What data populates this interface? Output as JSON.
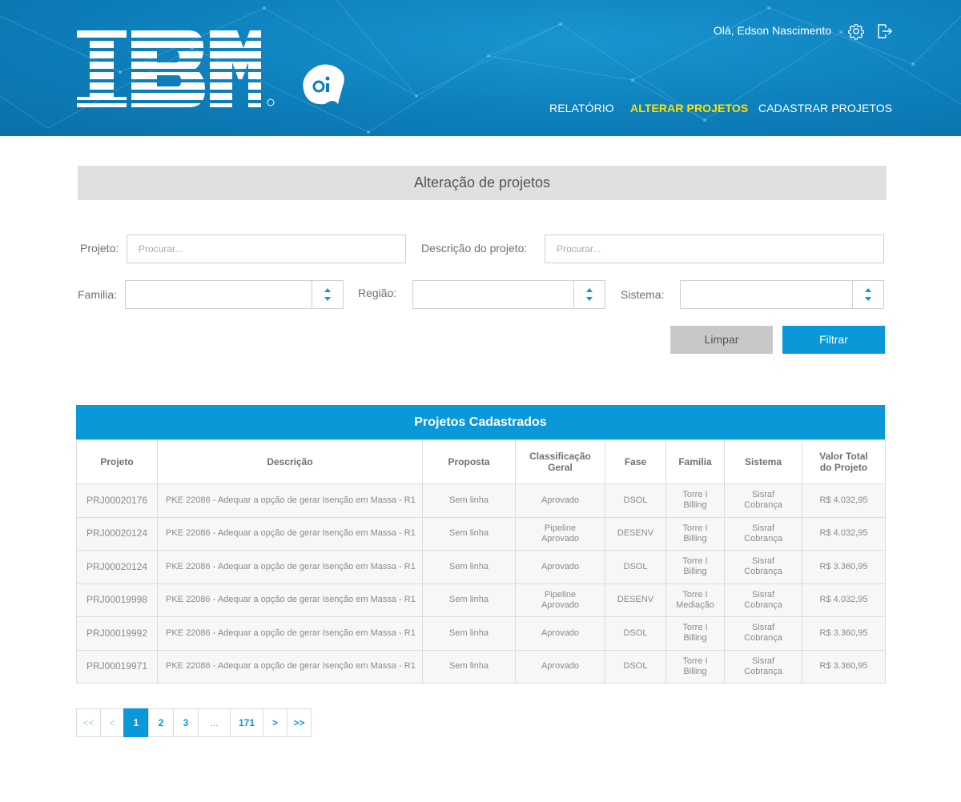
{
  "header": {
    "brand_primary": "IBM",
    "brand_secondary": "oi",
    "greeting": "Olá, Edson Nascimento",
    "icons": [
      "gear-icon",
      "logout-icon"
    ],
    "nav": [
      {
        "label": "RELATÓRIO",
        "active": false
      },
      {
        "label": "ALTERAR PROJETOS",
        "active": true
      },
      {
        "label": "CADASTRAR PROJETOS",
        "active": false
      }
    ]
  },
  "page_title": "Alteração de projetos",
  "filters": {
    "projeto": {
      "label": "Projeto:",
      "placeholder": "Procurar...",
      "value": ""
    },
    "descricao": {
      "label": "Descrição do projeto:",
      "placeholder": "Procurar...",
      "value": ""
    },
    "familia": {
      "label": "Familia:",
      "value": ""
    },
    "regiao": {
      "label": "Região:",
      "value": ""
    },
    "sistema": {
      "label": "Sistema:",
      "value": ""
    }
  },
  "buttons": {
    "clear": "Limpar",
    "filter": "Filtrar"
  },
  "table": {
    "title": "Projetos Cadastrados",
    "columns": [
      "Projeto",
      "Descrição",
      "Proposta",
      "Classificação Geral",
      "Fase",
      "Familia",
      "Sistema",
      "Valor Total do Projeto"
    ],
    "rows": [
      [
        "PRJ00020176",
        "PKE 22086 - Adequar a opção de gerar Isenção em Massa - R1",
        "Sem linha",
        "Aprovado",
        "DSOL",
        "Torre I Billing",
        "Sisraf Cobrança",
        "R$ 4.032,95"
      ],
      [
        "PRJ00020124",
        "PKE 22086 - Adequar a opção de gerar Isenção em Massa - R1",
        "Sem linha",
        "Pipeline Aprovado",
        "DESENV",
        "Torre I Billing",
        "Sisraf Cobrança",
        "R$ 4.032,95"
      ],
      [
        "PRJ00020124",
        "PKE 22086 - Adequar a opção de gerar Isenção em Massa - R1",
        "Sem linha",
        "Aprovado",
        "DSOL",
        "Torre I Billing",
        "Sisraf Cobrança",
        "R$ 3.360,95"
      ],
      [
        "PRJ00019998",
        "PKE 22086 - Adequar a opção de gerar Isenção em Massa - R1",
        "Sem linha",
        "Pipeline Aprovado",
        "DESENV",
        "Torre I Mediação",
        "Sisraf Cobrança",
        "R$ 4.032,95"
      ],
      [
        "PRJ00019992",
        "PKE 22086 - Adequar a opção de gerar Isenção em Massa - R1",
        "Sem linha",
        "Aprovado",
        "DSOL",
        "Torre I Billing",
        "Sisraf Cobrança",
        "R$ 3.360,95"
      ],
      [
        "PRJ00019971",
        "PKE 22086 - Adequar a opção de gerar Isenção em Massa - R1",
        "Sem linha",
        "Aprovado",
        "DSOL",
        "Torre I Billing",
        "Sisraf Cobrança",
        "R$ 3.360,95"
      ]
    ]
  },
  "pagination": {
    "first": "<<",
    "prev": "<",
    "pages": [
      "1",
      "2",
      "3"
    ],
    "ellipsis": "...",
    "last_page": "171",
    "next": ">",
    "last": ">>",
    "current": "1"
  },
  "colors": {
    "header_blue": "#0d7fbb",
    "accent_blue": "#0a98d9",
    "active_nav": "#ffe100",
    "title_bar": "#e0e0e0"
  }
}
